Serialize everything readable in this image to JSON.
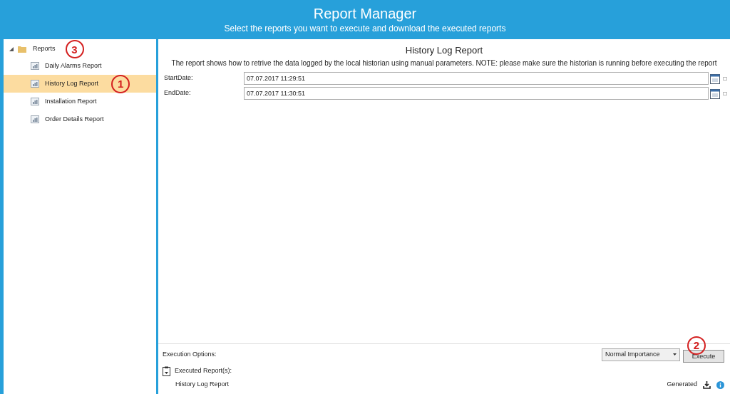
{
  "header": {
    "title": "Report Manager",
    "subtitle": "Select the reports you want to execute and download the executed reports"
  },
  "tree": {
    "label": "Reports",
    "expanded": true,
    "callout": "3",
    "children": [
      {
        "label": "Daily Alarms Report",
        "selected": false
      },
      {
        "label": "History Log Report",
        "selected": true,
        "callout": "1"
      },
      {
        "label": "Installation Report",
        "selected": false
      },
      {
        "label": "Order Details Report",
        "selected": false
      }
    ]
  },
  "report": {
    "title": "History Log Report",
    "description": "The report shows how to retrive the data logged by the local historian using manual parameters. NOTE: please make sure the historian is running before executing the report",
    "fields": [
      {
        "label": "StartDate:",
        "value": "07.07.2017 11:29:51"
      },
      {
        "label": "EndDate:",
        "value": "07.07.2017 11:30:51"
      }
    ]
  },
  "execution": {
    "label": "Execution Options:",
    "importance": "Normal Importance",
    "button": "Execute",
    "callout": "2",
    "executed_label": "Executed Report(s):",
    "executed": [
      {
        "name": "History Log Report",
        "status": "Generated"
      }
    ]
  }
}
